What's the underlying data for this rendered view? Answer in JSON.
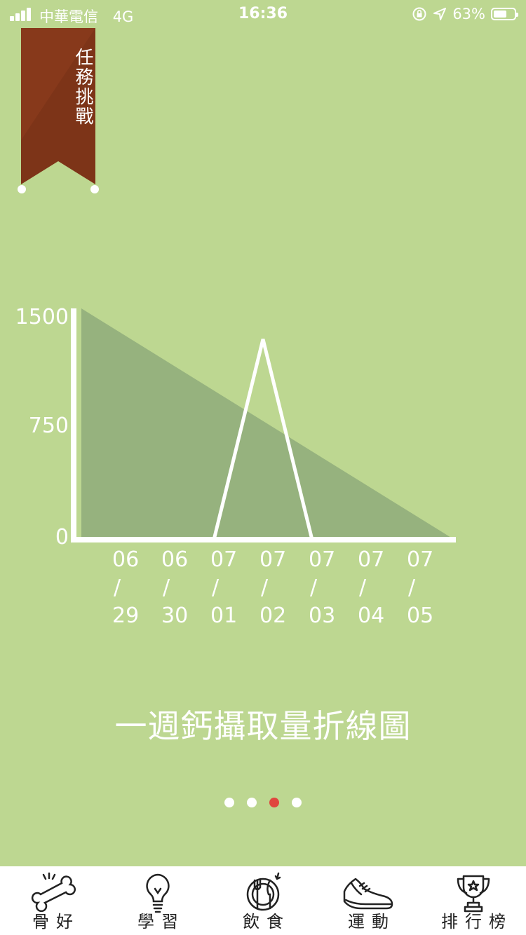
{
  "status_bar": {
    "carrier": "中華電信",
    "network": "4G",
    "time": "16:36",
    "battery": "63%",
    "battery_level": 0.63
  },
  "ribbon": {
    "label": "任務挑戰",
    "color": "#7d3418"
  },
  "chart_data": {
    "type": "area",
    "title": "一週鈣攝取量折線圖",
    "categories": [
      "06\n/\n29",
      "06\n/\n30",
      "07\n/\n01",
      "07\n/\n02",
      "07\n/\n03",
      "07\n/\n04",
      "07\n/\n05"
    ],
    "yticks": [
      0,
      750,
      1500
    ],
    "ylim": [
      0,
      1500
    ],
    "series": [
      {
        "kind": "area",
        "values": [
          1500,
          1250,
          1000,
          750,
          500,
          250,
          0
        ],
        "color": "#96b27e"
      },
      {
        "kind": "line",
        "values": [
          0,
          0,
          0,
          1300,
          0,
          0,
          0
        ],
        "color": "#ffffff"
      }
    ]
  },
  "pager": {
    "count": 4,
    "active": 2,
    "active_color": "#e0463e"
  },
  "tabs": [
    {
      "label": "骨好",
      "icon": "bone-icon"
    },
    {
      "label": "學習",
      "icon": "lightbulb-icon"
    },
    {
      "label": "飲食",
      "icon": "plate-cutlery-icon"
    },
    {
      "label": "運動",
      "icon": "sneaker-icon"
    },
    {
      "label": "排行榜",
      "icon": "trophy-icon"
    }
  ],
  "colors": {
    "background": "#bdd791",
    "tab_bar": "#ffffff"
  }
}
